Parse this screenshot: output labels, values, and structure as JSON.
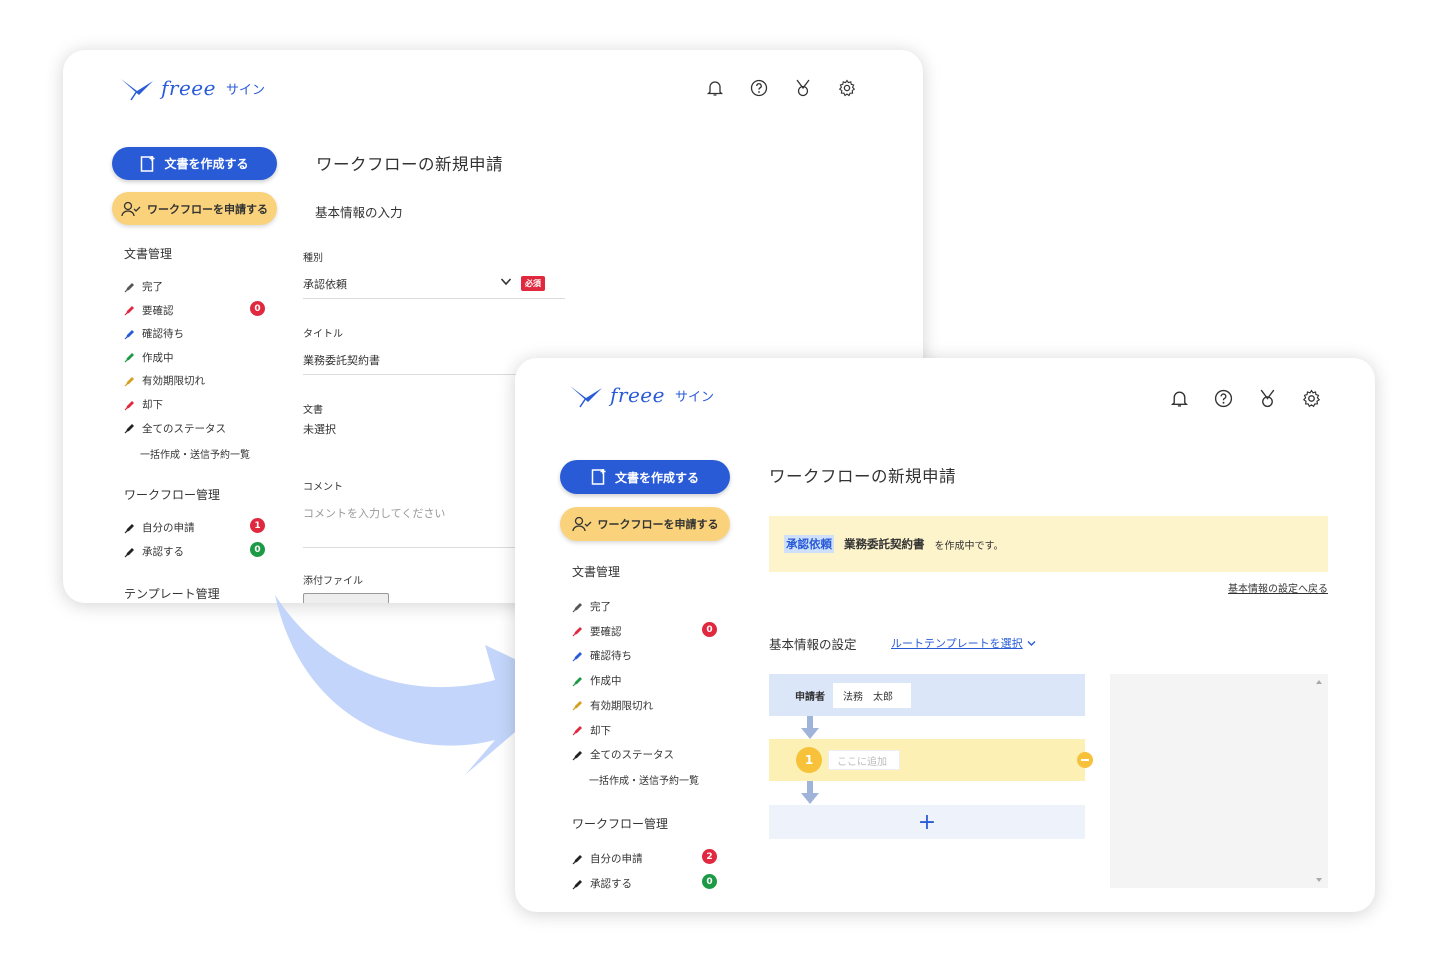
{
  "logo": {
    "word": "freee",
    "sub": "サイン"
  },
  "header_icons": [
    "bell-icon",
    "help-icon",
    "medal-icon",
    "gear-icon"
  ],
  "sidebar": {
    "create_document": "文書を作成する",
    "apply_workflow": "ワークフローを申請する",
    "doc_management": "文書管理",
    "items": [
      {
        "label": "完了",
        "color": "#555555"
      },
      {
        "label": "要確認",
        "color": "#e0283e"
      },
      {
        "label": "確認待ち",
        "color": "#2a5bd7"
      },
      {
        "label": "作成中",
        "color": "#1d9a46"
      },
      {
        "label": "有効期限切れ",
        "color": "#d4a020"
      },
      {
        "label": "却下",
        "color": "#e0283e"
      },
      {
        "label": "全てのステータス",
        "color": "#222222"
      }
    ],
    "batch": "一括作成・送信予約一覧",
    "workflow_management": "ワークフロー管理",
    "workflow_items": [
      {
        "label": "自分の申請"
      },
      {
        "label": "承認する"
      }
    ],
    "template_management": "テンプレート管理"
  },
  "back": {
    "badges": {
      "needs_check": "0",
      "my_requests": "1",
      "approve": "0"
    },
    "page_title": "ワークフローの新規申請",
    "section_title": "基本情報の入力",
    "type_label": "種別",
    "type_value": "承認依頼",
    "required": "必須",
    "title_label": "タイトル",
    "title_value": "業務委託契約書",
    "document_label": "文書",
    "document_value": "未選択",
    "comment_label": "コメント",
    "comment_placeholder": "コメントを入力してください",
    "attach_label": "添付ファイル"
  },
  "front": {
    "badges": {
      "needs_check": "0",
      "my_requests": "2",
      "approve": "0"
    },
    "page_title": "ワークフローの新規申請",
    "notice": {
      "type": "承認依頼",
      "doc": "業務委託契約書",
      "suffix": "を作成中です。"
    },
    "back_link": "基本情報の設定へ戻る",
    "settings_title": "基本情報の設定",
    "route_template": "ルートテンプレートを選択",
    "applicant_label": "申請者",
    "applicant_name": "法務　太郎",
    "step_number": "1",
    "step_placeholder": "ここに追加",
    "add_symbol": "+"
  },
  "colors": {
    "brand": "#2a5bd7",
    "accent": "#f9d27b",
    "danger": "#e0283e",
    "success": "#1d9a46"
  }
}
